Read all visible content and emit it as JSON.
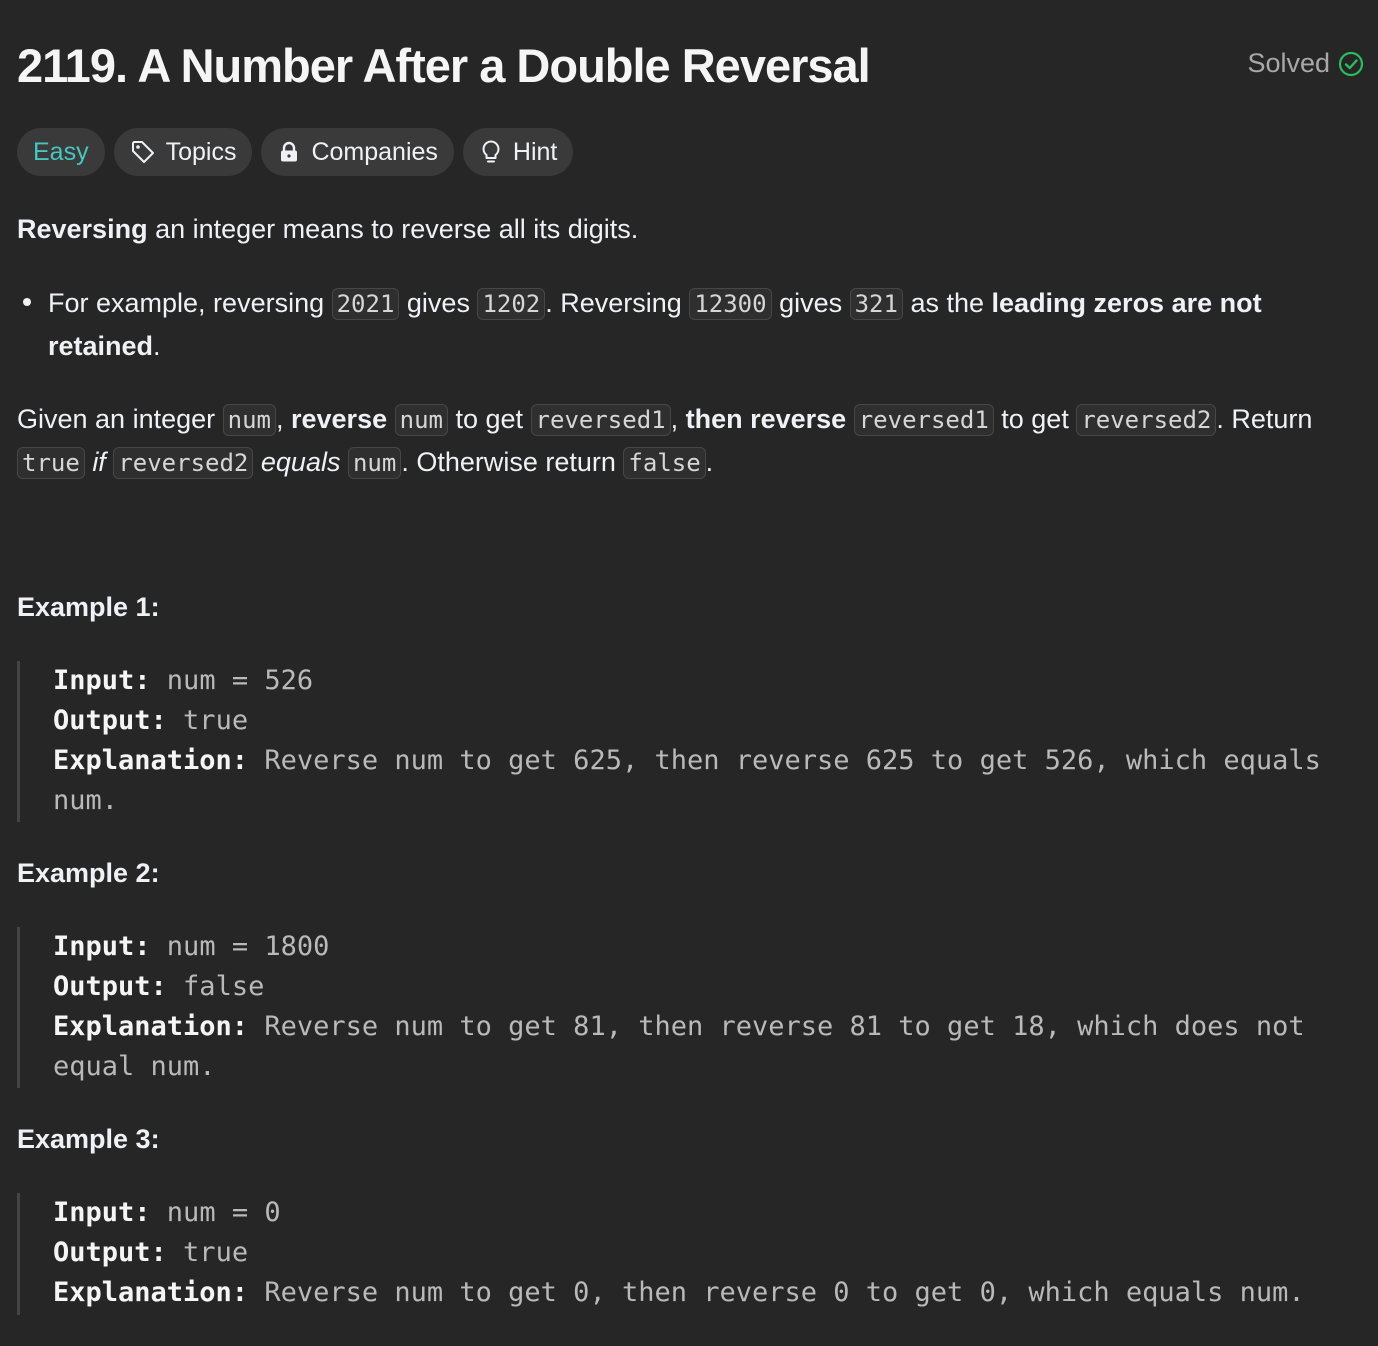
{
  "header": {
    "title": "2119. A Number After a Double Reversal",
    "status": "Solved",
    "status_color": "#2cbb5d"
  },
  "tags": {
    "difficulty": "Easy",
    "topics": "Topics",
    "companies": "Companies",
    "hint": "Hint"
  },
  "description": {
    "p1_bold": "Reversing",
    "p1_rest": " an integer means to reverse all its digits.",
    "bullet": {
      "t1": "For example, reversing ",
      "c1": "2021",
      "t2": " gives ",
      "c2": "1202",
      "t3": ". Reversing ",
      "c3": "12300",
      "t4": " gives ",
      "c4": "321",
      "t5": " as the ",
      "b1": "leading zeros are not retained",
      "t6": "."
    },
    "given": {
      "t1": "Given an integer ",
      "c1": "num",
      "t2": ", ",
      "b1": "reverse",
      "t3": " ",
      "c2": "num",
      "t4": " to get ",
      "c3": "reversed1",
      "t5": ", ",
      "b2": "then reverse",
      "t6": " ",
      "c4": "reversed1",
      "t7": " to get ",
      "c5": "reversed2",
      "t8": ". Return ",
      "c6": "true",
      "t9": " ",
      "i1": "if",
      "t10": " ",
      "c7": "reversed2",
      "t11": " ",
      "i2": "equals",
      "t12": " ",
      "c8": "num",
      "t13": ". Otherwise return ",
      "c9": "false",
      "t14": "."
    }
  },
  "examples": [
    {
      "heading": "Example 1:",
      "input_label": "Input:",
      "input": " num = 526",
      "output_label": "Output:",
      "output": " true",
      "explanation_label": "Explanation:",
      "explanation": " Reverse num to get 625, then reverse 625 to get 526, which equals num."
    },
    {
      "heading": "Example 2:",
      "input_label": "Input:",
      "input": " num = 1800",
      "output_label": "Output:",
      "output": " false",
      "explanation_label": "Explanation:",
      "explanation": " Reverse num to get 81, then reverse 81 to get 18, which does not equal num."
    },
    {
      "heading": "Example 3:",
      "input_label": "Input:",
      "input": " num = 0",
      "output_label": "Output:",
      "output": " true",
      "explanation_label": "Explanation:",
      "explanation": " Reverse num to get 0, then reverse 0 to get 0, which equals num."
    }
  ]
}
